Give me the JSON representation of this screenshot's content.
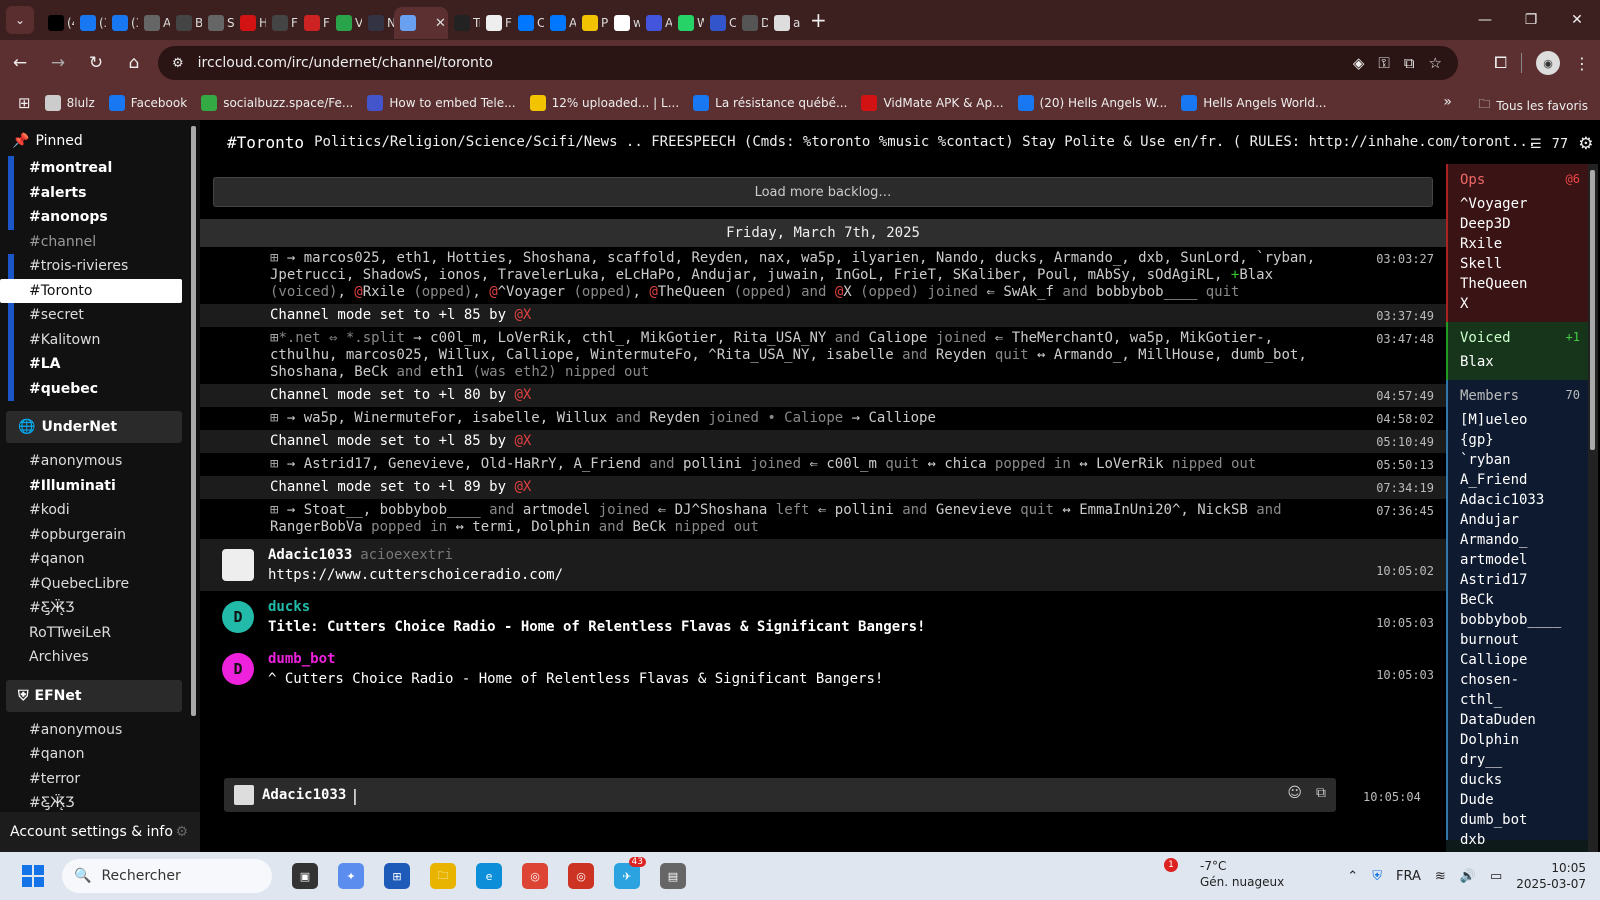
{
  "browser": {
    "tabs": [
      {
        "label": "(4",
        "color": "#000000"
      },
      {
        "label": "(3",
        "color": "#1877f2"
      },
      {
        "label": "(3",
        "color": "#1877f2"
      },
      {
        "label": "Ac",
        "color": "#666666"
      },
      {
        "label": "Bl",
        "color": "#444444"
      },
      {
        "label": "Se",
        "color": "#666666"
      },
      {
        "label": "Hc",
        "color": "#d31313"
      },
      {
        "label": "Fi",
        "color": "#444444"
      },
      {
        "label": "Fi",
        "color": "#cc2222"
      },
      {
        "label": "Vi",
        "color": "#2aa44a"
      },
      {
        "label": "N",
        "color": "#333344"
      },
      {
        "label": "",
        "color": "#6aa0f0",
        "active": true
      },
      {
        "label": "Tr",
        "color": "#222222"
      },
      {
        "label": "Fc",
        "color": "#eeeeee"
      },
      {
        "label": "Cu",
        "color": "#0077ff"
      },
      {
        "label": "Ac",
        "color": "#0077ff"
      },
      {
        "label": "Pr",
        "color": "#f2c300"
      },
      {
        "label": "w",
        "color": "#ffffff"
      },
      {
        "label": "Ac",
        "color": "#4455dd"
      },
      {
        "label": "W",
        "color": "#25d366"
      },
      {
        "label": "CC",
        "color": "#3355cc"
      },
      {
        "label": "Dc",
        "color": "#555555"
      },
      {
        "label": "ai",
        "color": "#dddddd"
      }
    ],
    "url": "irccloud.com/irc/undernet/channel/toronto",
    "bookmarks": [
      {
        "label": "8lulz",
        "color": "#cccccc"
      },
      {
        "label": "Facebook",
        "color": "#1877f2"
      },
      {
        "label": "socialbuzz.space/Fe...",
        "color": "#33aa44"
      },
      {
        "label": "How to embed Tele...",
        "color": "#4455cc"
      },
      {
        "label": "12% uploaded... | L...",
        "color": "#f2c300"
      },
      {
        "label": "La résistance québé...",
        "color": "#1877f2"
      },
      {
        "label": "VidMate APK & Ap...",
        "color": "#d31313"
      },
      {
        "label": "(20) Hells Angels W...",
        "color": "#1877f2"
      },
      {
        "label": "Hells Angels World...",
        "color": "#1877f2"
      }
    ],
    "all_bookmarks": "Tous les favoris"
  },
  "sidebar": {
    "pinned_label": "Pinned",
    "pinned": [
      {
        "name": "#montreal",
        "style": "bold",
        "bar": true
      },
      {
        "name": "#alerts",
        "style": "bold",
        "bar": true
      },
      {
        "name": "#anonops",
        "style": "bold",
        "bar": true
      },
      {
        "name": "#channel",
        "style": "dim",
        "bar": false
      },
      {
        "name": "#trois-rivieres",
        "style": "normal",
        "bar": true
      },
      {
        "name": "#Toronto",
        "style": "sel",
        "bar": false
      },
      {
        "name": "#secret",
        "style": "normal",
        "bar": true
      },
      {
        "name": "#Kalitown",
        "style": "normal",
        "bar": true
      },
      {
        "name": "#LA",
        "style": "bold",
        "bar": true
      },
      {
        "name": "#quebec",
        "style": "bold",
        "bar": true
      }
    ],
    "server1": "UnderNet",
    "server1_channels": [
      {
        "name": "#anonymous",
        "style": "normal"
      },
      {
        "name": "#Illuminati",
        "style": "bold"
      },
      {
        "name": "#kodi",
        "style": "normal"
      },
      {
        "name": "#opburgerain",
        "style": "normal"
      },
      {
        "name": "#qanon",
        "style": "normal"
      },
      {
        "name": "#QuebecLibre",
        "style": "normal"
      },
      {
        "name": "#Ƹ̵̡Ӝ̵̨̄Ʒ",
        "style": "normal"
      },
      {
        "name": "RoTTweiLeR",
        "style": "normal"
      },
      {
        "name": "Archives",
        "style": "normal"
      }
    ],
    "server2": "EFNet",
    "server2_channels": [
      {
        "name": "#anonymous",
        "style": "normal"
      },
      {
        "name": "#qanon",
        "style": "normal"
      },
      {
        "name": "#terror",
        "style": "normal"
      },
      {
        "name": "#Ƹ̵̡Ӝ̵̨̄Ʒ",
        "style": "normal"
      }
    ],
    "account": "Account settings & info"
  },
  "channel": {
    "name": "#Toronto",
    "topic": "Politics/Religion/Science/Scifi/News .. FREESPEECH (Cmds: %toronto %music %contact) Stay Polite & Use en/fr. ( RULES: http://inhahe.com/toront...",
    "user_count": "77",
    "load_more": "Load more backlog…",
    "date": "Friday, March 7th, 2025"
  },
  "log": [
    {
      "alt": false,
      "ts": "03:03:27",
      "html": "<span class='exp'>⊞</span> → marcos025, eth1, Hotties, Shoshana, scaffold, Reyden, nax, wa5p, ilyarien, Nando, ducks, Armando_, dxb, SunLord, `ryban, Jpetrucci, ShadowS, ionos, TravelerLuka, eLcHaPo, Andujar, juwain, InGoL, FrieT, SKaliber, Poul, mAbSy, sOdAgiRL, <span class='plus'>+</span>Blax <span class='dim'>(voiced)</span>, <span class='at'>@</span>Rxile <span class='dim'>(opped)</span>, <span class='at'>@</span>^Voyager <span class='dim'>(opped)</span>, <span class='at'>@</span>TheQueen <span class='dim'>(opped) and</span> <span class='at'>@</span>X <span class='dim'>(opped) joined</span>  ⇐ SwAk_f <span class='dim'>and</span> bobbybob____ <span class='dim'>quit</span>"
    },
    {
      "alt": true,
      "mode": true,
      "ts": "03:37:49",
      "html": "Channel mode set to +l 85 by <span class='at'>@X</span>"
    },
    {
      "alt": false,
      "ts": "03:47:48",
      "html": "<span class='exp'>⊞</span><span class='dim'>*.net ⇔ *.split</span> → c00l_m, LoVerRik, cthl_, MikGotier, Rita_USA_NY <span class='dim'>and</span> Caliope <span class='dim'>joined</span>  ⇐ TheMerchantO, wa5p, MikGotier-, cthulhu, marcos025, Willux, Calliope, WintermuteFo, ^Rita_USA_NY, isabelle <span class='dim'>and</span> Reyden <span class='dim'>quit</span>  ↔ Armando_, MillHouse, dumb_bot, Shoshana, BeCk <span class='dim'>and</span> eth1 <span class='dim'>(was eth2) nipped out</span>"
    },
    {
      "alt": true,
      "mode": true,
      "ts": "04:57:49",
      "html": "Channel mode set to +l 80 by <span class='at'>@X</span>"
    },
    {
      "alt": false,
      "ts": "04:58:02",
      "html": "<span class='exp'>⊞</span> → wa5p, WinermuteFor, isabelle, Willux <span class='dim'>and</span> Reyden <span class='dim'>joined  •  Caliope</span> → Calliope"
    },
    {
      "alt": true,
      "mode": true,
      "ts": "05:10:49",
      "html": "Channel mode set to +l 85 by <span class='at'>@X</span>"
    },
    {
      "alt": false,
      "ts": "05:50:13",
      "html": "<span class='exp'>⊞</span> → Astrid17, Genevieve, Old-HaRrY, A_Friend <span class='dim'>and</span> pollini <span class='dim'>joined</span>  ⇐ c00l_m <span class='dim'>quit</span>  ↔ chica <span class='dim'>popped in</span>  ↔ LoVerRik <span class='dim'>nipped out</span>"
    },
    {
      "alt": true,
      "mode": true,
      "ts": "07:34:19",
      "html": "Channel mode set to +l 89 by <span class='at'>@X</span>"
    },
    {
      "alt": false,
      "ts": "07:36:45",
      "html": "<span class='exp'>⊞</span> → Stoat__, bobbybob____ <span class='dim'>and</span> artmodel <span class='dim'>joined</span>  ⇐ DJ^Shoshana <span class='dim'>left</span>  ⇐ pollini <span class='dim'>and</span> Genevieve <span class='dim'>quit</span>  ↔ EmmaInUni20^, NickSB <span class='dim'>and</span> RangerBobVa <span class='dim'>popped in</span>  ↔ termi, Dolphin <span class='dim'>and</span> BeCk <span class='dim'>nipped out</span>"
    }
  ],
  "messages": [
    {
      "nick": "Adacic1033",
      "ident": "acioexextri",
      "text": "https://www.cutterschoiceradio.com/",
      "ts": "10:05:02",
      "avatar": "",
      "color": "#ffffff",
      "alt": true,
      "square": true
    },
    {
      "nick": "ducks",
      "ident": "",
      "text": "Title: Cutters Choice Radio - Home of Relentless Flavas & Significant Bangers!",
      "ts": "10:05:03",
      "avatar": "D",
      "color": "#22bbaa",
      "alt": false,
      "bold": true
    },
    {
      "nick": "dumb_bot",
      "ident": "",
      "text": "^ Cutters Choice Radio - Home of Relentless Flavas & Significant Bangers!",
      "ts": "10:05:03",
      "avatar": "D",
      "color": "#ee22dd",
      "alt": false
    }
  ],
  "input": {
    "nick": "Adacic1033",
    "ts": "10:05:04"
  },
  "members": {
    "ops_label": "Ops",
    "ops_count": "@6",
    "ops": [
      "^Voyager",
      "Deep3D",
      "Rxile",
      "Skell",
      "TheQueen",
      "X"
    ],
    "voiced_label": "Voiced",
    "voiced_count": "+1",
    "voiced": [
      "Blax"
    ],
    "members_label": "Members",
    "members_count": "70",
    "members": [
      "[M]ueleo",
      "{gp}",
      "`ryban",
      "A_Friend",
      "Adacic1033",
      "Andujar",
      "Armando_",
      "artmodel",
      "Astrid17",
      "BeCk",
      "bobbybob____",
      "burnout",
      "Calliope",
      "chosen-",
      "cthl_",
      "DataDuden",
      "Dolphin",
      "dry__",
      "ducks",
      "Dude",
      "dumb_bot",
      "dxb"
    ]
  },
  "taskbar": {
    "search": "Rechercher",
    "weather_temp": "-7°C",
    "weather_desc": "Gén. nuageux",
    "weather_badge": "1",
    "lang": "FRA",
    "time": "10:05",
    "date": "2025-03-07",
    "telegram_badge": "43"
  }
}
